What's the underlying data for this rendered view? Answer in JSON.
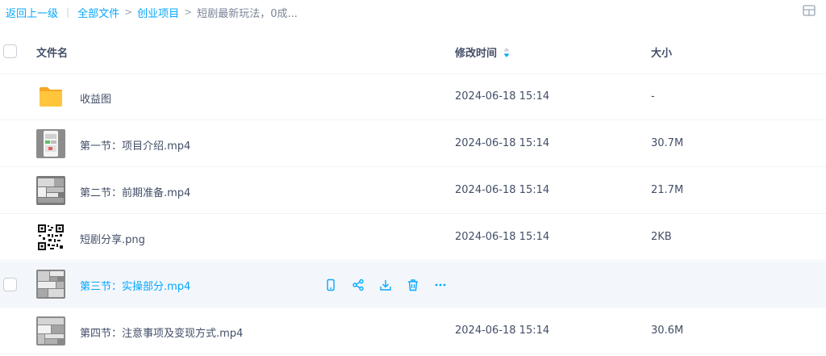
{
  "breadcrumb": {
    "back": "返回上一级",
    "all_files": "全部文件",
    "project": "创业项目",
    "current": "短剧最新玩法，0成..."
  },
  "header": {
    "name": "文件名",
    "modified": "修改时间",
    "size": "大小"
  },
  "colors": {
    "accent": "#06a7ff",
    "text": "#424e67",
    "row_hover": "#f3f7fb",
    "folder": "#ffc53d"
  },
  "files": [
    {
      "name": "收益图",
      "modified": "2024-06-18 15:14",
      "size": "-",
      "icon": "folder-icon"
    },
    {
      "name": "第一节：项目介绍.mp4",
      "modified": "2024-06-18 15:14",
      "size": "30.7M",
      "icon": "video-thumbnail"
    },
    {
      "name": "第二节：前期准备.mp4",
      "modified": "2024-06-18 15:14",
      "size": "21.7M",
      "icon": "video-thumbnail"
    },
    {
      "name": "短剧分享.png",
      "modified": "2024-06-18 15:14",
      "size": "2KB",
      "icon": "qr-code-thumbnail"
    },
    {
      "name": "第三节：实操部分.mp4",
      "modified": "",
      "size": "",
      "icon": "video-thumbnail"
    },
    {
      "name": "第四节：注意事项及变现方式.mp4",
      "modified": "2024-06-18 15:14",
      "size": "30.6M",
      "icon": "video-thumbnail"
    }
  ],
  "row_actions": [
    "phone-icon",
    "share-icon",
    "download-icon",
    "delete-icon",
    "more-icon"
  ]
}
